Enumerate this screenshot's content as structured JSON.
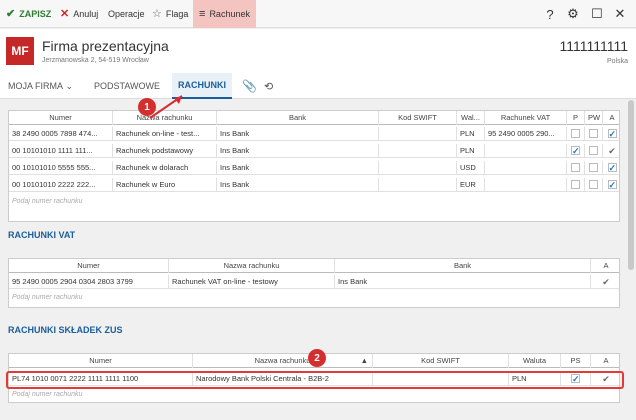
{
  "toolbar": {
    "save": "ZAPISZ",
    "cancel": "Anuluj",
    "operations": "Operacje",
    "flag": "Flaga",
    "accounts": "Rachunek",
    "help": "?"
  },
  "header": {
    "initials": "MF",
    "name": "Firma prezentacyjna",
    "address": "Jerzmanowska 2, 54-519 Wrocław",
    "id": "1111111111",
    "country": "Polska"
  },
  "tabs": [
    "MOJA FIRMA",
    "PODSTAWOWE",
    "RACHUNKI"
  ],
  "accounts_table": {
    "headers": [
      "Numer",
      "Nazwa rachunku",
      "Bank",
      "Kod SWIFT",
      "Wal...",
      "Rachunek VAT",
      "P",
      "PW",
      "A"
    ],
    "rows": [
      {
        "number": "38 2490 0005 7898 474...",
        "name": "Rachunek on-line - test...",
        "bank": "Ins Bank",
        "swift": "",
        "currency": "PLN",
        "vat": "95 2490 0005 290...",
        "p": false,
        "pw": false,
        "a": true
      },
      {
        "number": "00 10101010 1111 111...",
        "name": "Rachunek podstawowy",
        "bank": "Ins Bank",
        "swift": "",
        "currency": "PLN",
        "vat": "",
        "p": true,
        "pw": false,
        "a": "tick"
      },
      {
        "number": "00 10101010 5555 555...",
        "name": "Rachunek w dolarach",
        "bank": "Ins Bank",
        "swift": "",
        "currency": "USD",
        "vat": "",
        "p": false,
        "pw": false,
        "a": true
      },
      {
        "number": "00 10101010 2222 222...",
        "name": "Rachunek w Euro",
        "bank": "Ins Bank",
        "swift": "",
        "currency": "EUR",
        "vat": "",
        "p": false,
        "pw": false,
        "a": true
      }
    ],
    "placeholder": "Podaj numer rachunku"
  },
  "vat_section": {
    "title": "RACHUNKI VAT",
    "headers": [
      "Numer",
      "Nazwa rachunku",
      "Bank",
      "A"
    ],
    "rows": [
      {
        "number": "95 2490 0005 2904 0304 2803 3799",
        "name": "Rachunek VAT on-line - testowy",
        "bank": "Ins Bank"
      }
    ],
    "placeholder": "Podaj numer rachunku"
  },
  "zus_section": {
    "title": "RACHUNKI SKŁADEK ZUS",
    "headers": [
      "Numer",
      "Nazwa rachunku",
      "Kod SWIFT",
      "Waluta",
      "PS",
      "A"
    ],
    "rows": [
      {
        "number": "PL74 1010 0071 2222 1111 1111 1100",
        "name": "Narodowy Bank Polski Centrala - B2B-2",
        "swift": "",
        "currency": "PLN"
      }
    ],
    "placeholder": "Podaj numer rachunku"
  },
  "annotations": [
    "1",
    "2"
  ],
  "colors": {
    "accent": "#1a5d9c",
    "brand": "#c62828",
    "highlight": "#e53935"
  }
}
